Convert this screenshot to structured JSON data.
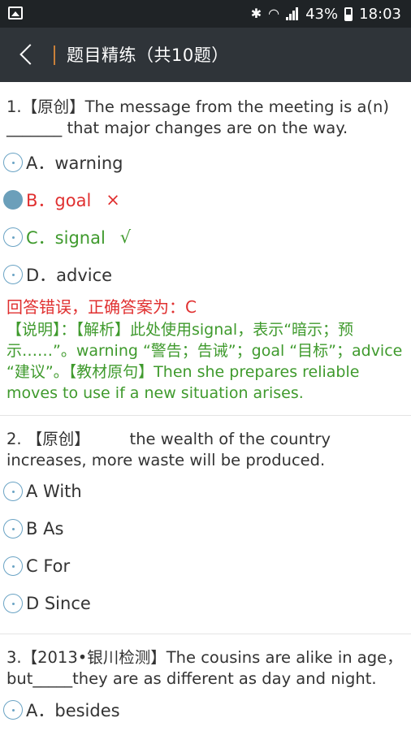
{
  "status_bar": {
    "battery": "43%",
    "time": "18:03"
  },
  "header": {
    "title": "题目精练（共10题）"
  },
  "questions": [
    {
      "text": "1.【原创】The message from the meeting is a(n) _______ that major changes are on the way.",
      "options": [
        {
          "label": "A．warning"
        },
        {
          "label": "B．goal",
          "mark": "×"
        },
        {
          "label": "C．signal",
          "mark": "√"
        },
        {
          "label": "D．advice"
        }
      ],
      "result": "回答错误，正确答案为：C",
      "explanation": "【说明】：【解析】此处使用signal，表示“暗示；预示……”。warning “警告；告诫”；goal “目标”；advice “建议”。【教材原句】Then she prepares reliable moves to use if a new situation arises."
    },
    {
      "text": "2. 【原创】　　　the wealth of the country increases, more waste will be produced.",
      "options": [
        {
          "label": "A With"
        },
        {
          "label": "B  As"
        },
        {
          "label": "C  For"
        },
        {
          "label": "D Since"
        }
      ]
    },
    {
      "text": "3.【2013•银川检测】The cousins are alike in age，but_____they are as different as day and night.",
      "options": [
        {
          "label": "A．besides"
        }
      ]
    }
  ]
}
